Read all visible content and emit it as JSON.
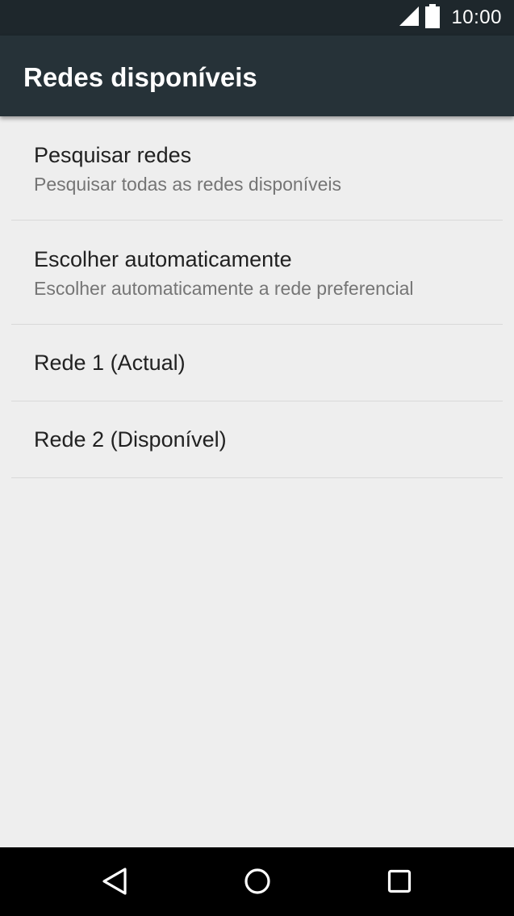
{
  "status_bar": {
    "time": "10:00",
    "icons": [
      "signal-icon",
      "battery-icon"
    ]
  },
  "app_bar": {
    "title": "Redes disponíveis"
  },
  "list": {
    "items": [
      {
        "title": "Pesquisar redes",
        "summary": "Pesquisar todas as redes disponíveis"
      },
      {
        "title": "Escolher automaticamente",
        "summary": "Escolher automaticamente a rede preferencial"
      },
      {
        "title": "Rede 1 (Actual)"
      },
      {
        "title": "Rede 2 (Disponível)"
      }
    ]
  },
  "nav_bar": {
    "icons": [
      "back-icon",
      "home-icon",
      "recents-icon"
    ]
  },
  "colors": {
    "status_bar": "#1e272c",
    "app_bar": "#263238",
    "background": "#eeeeee",
    "title_text": "#212121",
    "summary_text": "#757575",
    "divider": "#d9d9d9",
    "nav_bar": "#000000"
  }
}
